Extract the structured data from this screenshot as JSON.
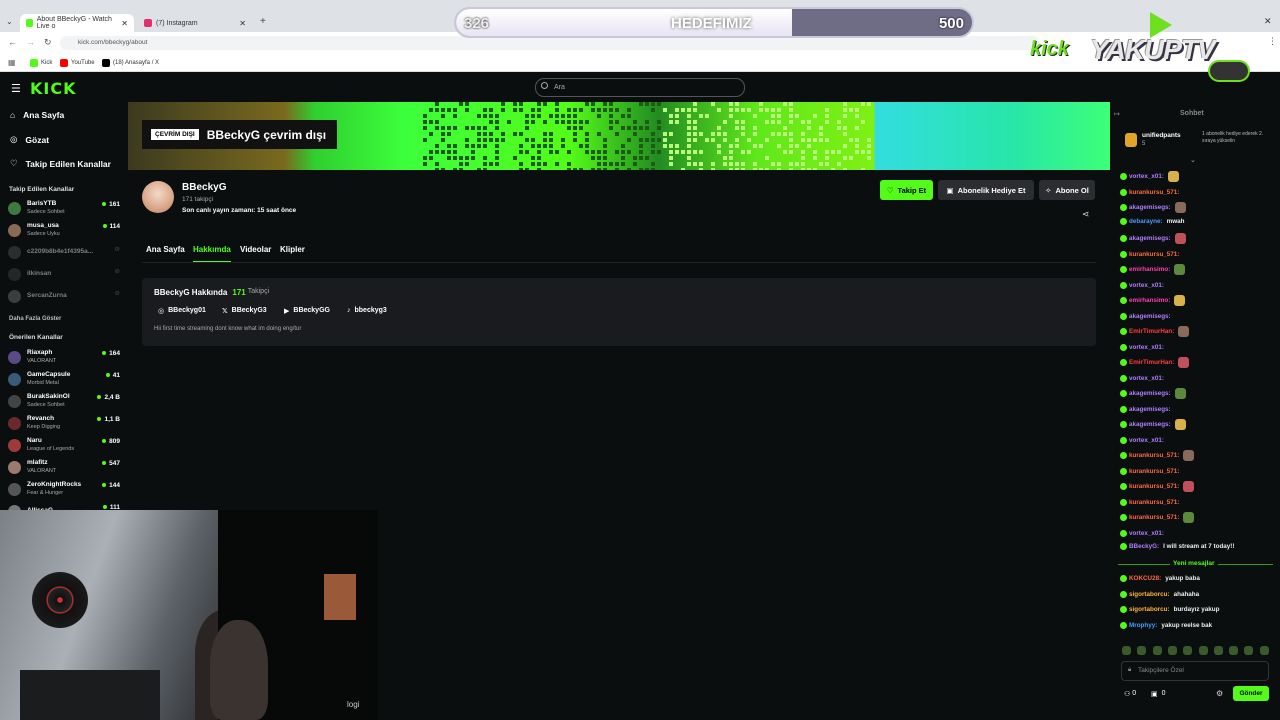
{
  "browser": {
    "tabs": [
      {
        "label": "About BBeckyG - Watch Live o",
        "active": true,
        "color": "#53fc18"
      },
      {
        "label": "(7) Instagram",
        "active": false,
        "color": "#e1306c"
      }
    ],
    "url": "kick.com/bbeckyg/about",
    "bookmarks": [
      "Kick",
      "YouTube",
      "(18) Anasayfa / X"
    ]
  },
  "overlay": {
    "goal_current": "326",
    "goal_label": "HEDEFIMIZ",
    "goal_target": "500",
    "goal_progress": 0.652,
    "logo_left": "kick",
    "logo_right": "YAKUPTV"
  },
  "kick": {
    "logo": "KICK",
    "search_placeholder": "Ara",
    "nav": [
      {
        "label": "Ana Sayfa",
        "icon": "home-icon"
      },
      {
        "label": "Gözat",
        "icon": "compass-icon"
      },
      {
        "label": "Takip Edilen Kanallar",
        "icon": "heart-icon"
      }
    ],
    "followed_header": "Takip Edilen Kanallar",
    "followed": [
      {
        "name": "BarisYTB",
        "category": "Sadece Sohbet",
        "viewers": "161",
        "color": "#3d7a3d"
      },
      {
        "name": "musa_usa",
        "category": "Sadece Uyku",
        "viewers": "114",
        "color": "#8a6a55"
      },
      {
        "name": "c2209b8b4e1f4395a...",
        "category": "",
        "viewers": "",
        "color": "#555"
      },
      {
        "name": "ilkinsan",
        "category": "",
        "viewers": "",
        "color": "#444"
      },
      {
        "name": "SercanZurna",
        "category": "",
        "viewers": "",
        "color": "#777"
      }
    ],
    "show_more": "Daha Fazla Göster",
    "recommended_header": "Önerilen Kanallar",
    "recommended": [
      {
        "name": "Riaxaph",
        "category": "VALORANT",
        "viewers": "164",
        "color": "#5a4a8a"
      },
      {
        "name": "GameCapsule",
        "category": "Morbid Metal",
        "viewers": "41",
        "color": "#3a5a7a"
      },
      {
        "name": "BurakSakinOl",
        "category": "Sadece Sohbet",
        "viewers": "2,4 B",
        "color": "#444"
      },
      {
        "name": "Revanch",
        "category": "Keep Digging",
        "viewers": "1,1 B",
        "color": "#6a2a2a"
      },
      {
        "name": "Naru",
        "category": "League of Legends",
        "viewers": "809",
        "color": "#a03a3a"
      },
      {
        "name": "mlafitz",
        "category": "VALORANT",
        "viewers": "547",
        "color": "#9a7a6a"
      },
      {
        "name": "ZeroKnightRocks",
        "category": "Fear & Hunger",
        "viewers": "144",
        "color": "#555"
      },
      {
        "name": "AllissaG",
        "category": "",
        "viewers": "111",
        "color": "#777"
      }
    ],
    "offline_badge": "ÇEVRİM DIŞI",
    "offline_text": "BBeckyG çevrim dışı",
    "channel": {
      "name": "BBeckyG",
      "followers": "171 takipçi",
      "last_live": "Son canlı yayın zamanı: 15 saat önce"
    },
    "actions": {
      "follow": "Takip Et",
      "gift": "Abonelik Hediye Et",
      "subscribe": "Abone Ol"
    },
    "tabs": [
      "Ana Sayfa",
      "Hakkımda",
      "Videolar",
      "Klipler"
    ],
    "active_tab": "Hakkımda",
    "about": {
      "title": "BBeckyG Hakkında",
      "follower_count": "171",
      "follower_label": "Takipçi",
      "socials": [
        {
          "icon": "instagram-icon",
          "handle": "BBeckyg01"
        },
        {
          "icon": "x-icon",
          "handle": "BBeckyG3"
        },
        {
          "icon": "youtube-icon",
          "handle": "BBeckyGG"
        },
        {
          "icon": "tiktok-icon",
          "handle": "bbeckyg3"
        }
      ],
      "bio": "Hii first time streaming dont know what im doing eng/tur"
    }
  },
  "chat": {
    "title": "Sohbet",
    "pinned_user": "unifiedpants",
    "pinned_count": "5",
    "pinned_text": "1 abonelik hediye ederek 2. sıraya yükselin",
    "messages": [
      {
        "user": "vortex_x01",
        "text": "",
        "color": "#b07cff"
      },
      {
        "user": "kurankursu_571",
        "text": "",
        "color": "#ff6a3d"
      },
      {
        "user": "akagemisegs",
        "text": "",
        "color": "#b07cff"
      },
      {
        "user": "debarayne",
        "text": "mwah",
        "color": "#4a9cff"
      },
      {
        "user": "akagemisegs",
        "text": "",
        "color": "#b07cff"
      },
      {
        "user": "kurankursu_571",
        "text": "",
        "color": "#ff6a3d"
      },
      {
        "user": "emirhansimo",
        "text": "",
        "color": "#ff3db0"
      },
      {
        "user": "vortex_x01",
        "text": "",
        "color": "#b07cff"
      },
      {
        "user": "emirhansimo",
        "text": "",
        "color": "#ff3db0"
      },
      {
        "user": "akagemisegs",
        "text": "",
        "color": "#b07cff"
      },
      {
        "user": "EmirTimurHan",
        "text": "",
        "color": "#ff3d3d"
      },
      {
        "user": "vortex_x01",
        "text": "",
        "color": "#b07cff"
      },
      {
        "user": "EmirTimurHan",
        "text": "",
        "color": "#ff3d3d"
      },
      {
        "user": "vortex_x01",
        "text": "",
        "color": "#b07cff"
      },
      {
        "user": "akagemisegs",
        "text": "",
        "color": "#b07cff"
      },
      {
        "user": "akagemisegs",
        "text": "",
        "color": "#b07cff"
      },
      {
        "user": "akagemisegs",
        "text": "",
        "color": "#b07cff"
      },
      {
        "user": "vortex_x01",
        "text": "",
        "color": "#b07cff"
      },
      {
        "user": "kurankursu_571",
        "text": "",
        "color": "#ff6a3d"
      },
      {
        "user": "kurankursu_571",
        "text": "",
        "color": "#ff6a3d"
      },
      {
        "user": "kurankursu_571",
        "text": "",
        "color": "#ff6a3d"
      },
      {
        "user": "kurankursu_571",
        "text": "",
        "color": "#ff6a3d"
      },
      {
        "user": "kurankursu_571",
        "text": "",
        "color": "#ff6a3d"
      },
      {
        "user": "vortex_x01",
        "text": "",
        "color": "#b07cff"
      },
      {
        "user": "BBeckyG",
        "text": "I will stream at 7 today!!",
        "color": "#b07cff"
      }
    ],
    "new_messages_label": "Yeni mesajlar",
    "new_messages": [
      {
        "user": "KOKCU28",
        "text": "yakup baba",
        "color": "#ff6a3d"
      },
      {
        "user": "sigortaborcu",
        "text": "ahahaha",
        "color": "#ffb23d"
      },
      {
        "user": "sigortaborcu",
        "text": "burdayız yakup",
        "color": "#ffb23d"
      },
      {
        "user": "Mrophyy",
        "text": "yakup reelse bak",
        "color": "#4a9cff"
      }
    ],
    "input_placeholder": "Takipçilere Özel",
    "counter1": "0",
    "counter2": "0",
    "send_label": "Gönder"
  },
  "webcam": {
    "brand": "logi"
  }
}
